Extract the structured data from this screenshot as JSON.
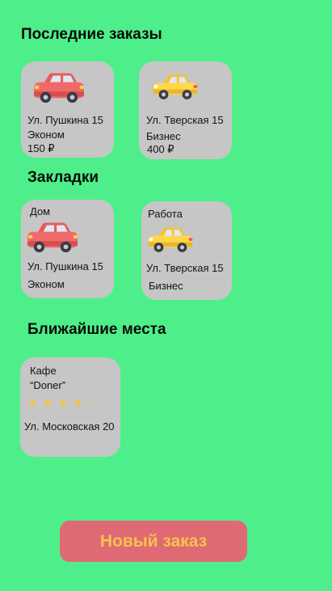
{
  "recent": {
    "title": "Последние заказы",
    "items": [
      {
        "address": "Ул. Пушкина 15",
        "class": "Эконом",
        "price": "150 ₽",
        "car_color": "red",
        "icon": "red-car-icon"
      },
      {
        "address": "Ул. Тверская 15",
        "class": "Бизнес",
        "price": "400 ₽",
        "car_color": "yellow",
        "icon": "yellow-car-icon"
      }
    ]
  },
  "bookmarks": {
    "title": "Закладки",
    "items": [
      {
        "name": "Дом",
        "address": "Ул. Пушкина 15",
        "class": "Эконом",
        "car_color": "red",
        "icon": "red-car-icon"
      },
      {
        "name": "Работа",
        "address": "Ул. Тверская 15",
        "class": "Бизнес",
        "car_color": "yellow",
        "icon": "yellow-car-icon"
      }
    ]
  },
  "nearby": {
    "title": "Ближайшие места",
    "items": [
      {
        "name_line1": "Кафе",
        "name_line2": "“Doner”",
        "rating": 4,
        "rating_max": 5,
        "address": "Ул. Московская 20"
      }
    ]
  },
  "actions": {
    "new_order_label": "Новый заказ"
  },
  "colors": {
    "background": "#4eef8a",
    "card": "#c6c6c6",
    "button": "#e06a73",
    "button_text": "#f6c24e",
    "star": "#f0c34a"
  }
}
